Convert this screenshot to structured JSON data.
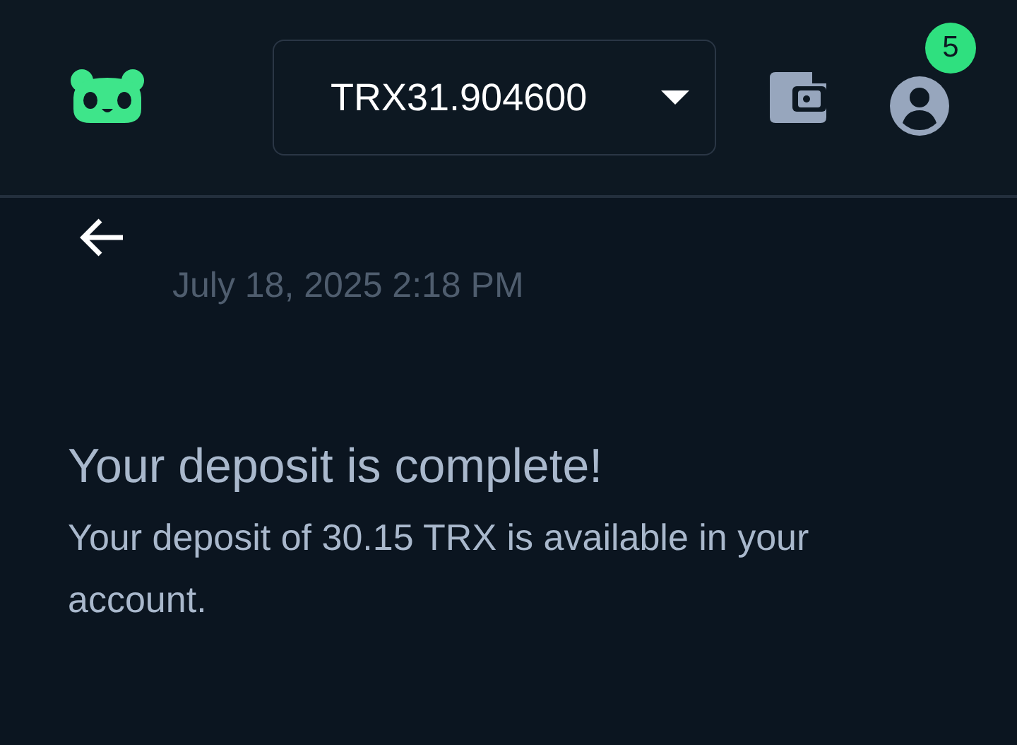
{
  "header": {
    "balance": "TRX31.904600",
    "notifications": "5"
  },
  "transaction": {
    "date": "July 18, 2025 2:18 PM",
    "title": "Your deposit is complete!",
    "message": "Your deposit of 30.15 TRX is available in your account."
  }
}
